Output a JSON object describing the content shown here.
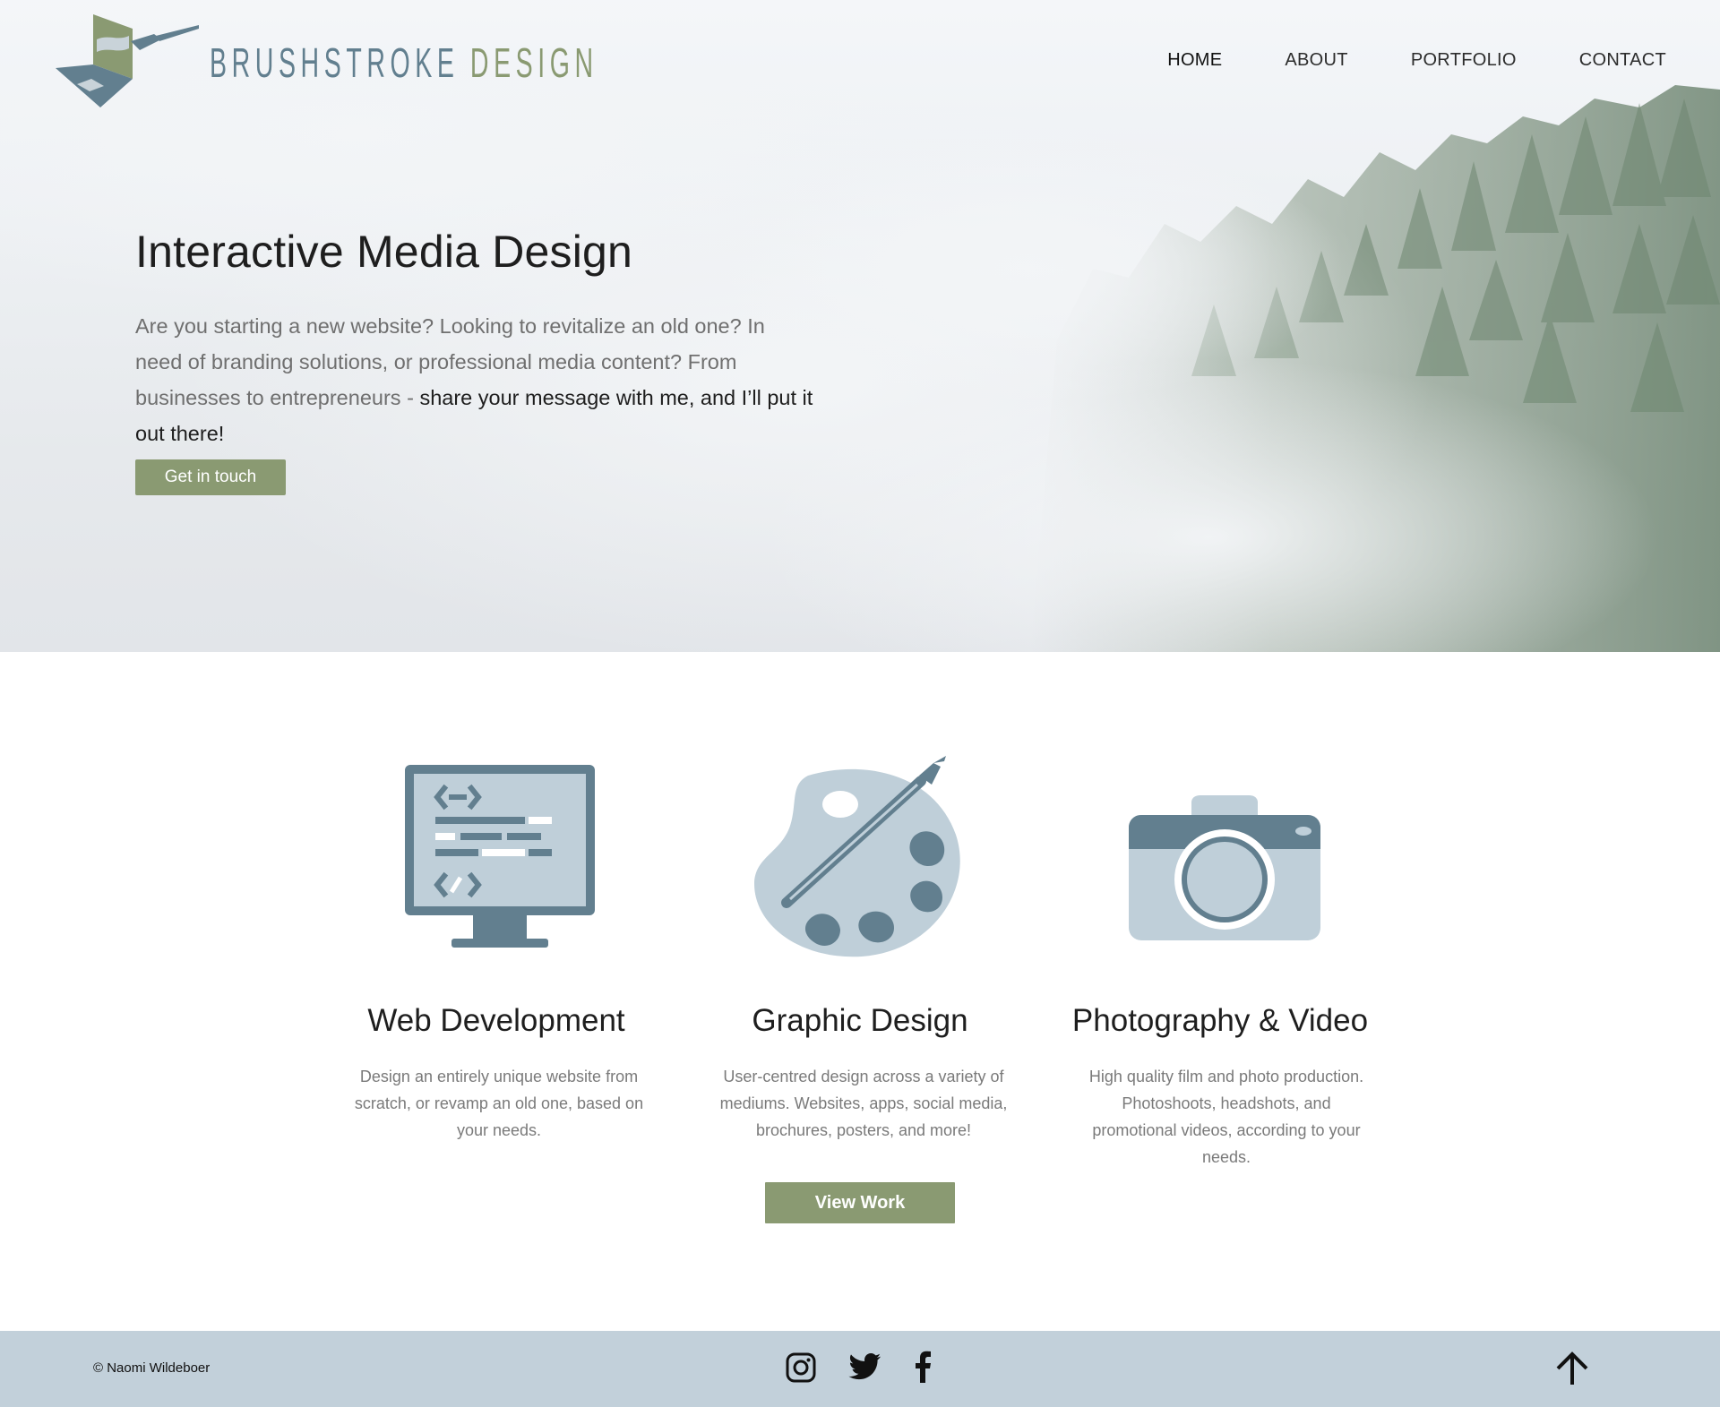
{
  "brand": {
    "name_part1": "BRUSHSTROKE",
    "name_part2": "DESIGN",
    "colors": {
      "slate": "#627f8f",
      "sage": "#8a9a72",
      "footer": "#c2d0da",
      "icon_light": "#bfcfd9"
    }
  },
  "nav": {
    "items": [
      {
        "label": "HOME",
        "active": true
      },
      {
        "label": "ABOUT",
        "active": false
      },
      {
        "label": "PORTFOLIO",
        "active": false
      },
      {
        "label": "CONTACT",
        "active": false
      }
    ]
  },
  "hero": {
    "title": "Interactive Media Design",
    "text_plain": "Are you starting a new website? Looking to revitalize an old one? In need of branding solutions, or professional media content? From businesses to entrepreneurs - ",
    "text_emphasis": "share your message with me, and I’ll put it out there!",
    "cta_label": "Get in touch"
  },
  "services": [
    {
      "icon": "monitor-code-icon",
      "title": "Web Development",
      "description": "Design an entirely unique website from scratch, or revamp an old one, based on your needs."
    },
    {
      "icon": "paint-palette-icon",
      "title": "Graphic Design",
      "description": "User-centred design across a variety of mediums. Websites, apps, social media, brochures, posters, and more!"
    },
    {
      "icon": "camera-icon",
      "title": "Photography & Video",
      "description": "High quality film and photo production. Photoshoots, headshots, and promotional videos, according to your needs."
    }
  ],
  "view_work_label": "View Work",
  "footer": {
    "copyright": "© Naomi Wildeboer",
    "social": [
      "instagram-icon",
      "twitter-icon",
      "facebook-icon"
    ],
    "back_to_top_icon": "arrow-up-icon"
  }
}
